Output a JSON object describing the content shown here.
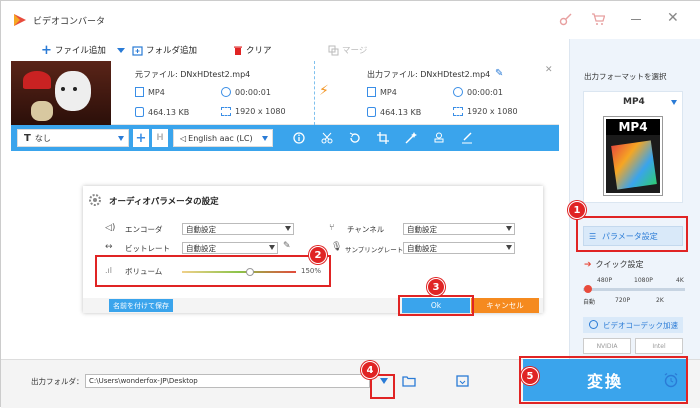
{
  "window": {
    "title": "ビデオコンバータ"
  },
  "toolbar": {
    "add_file": "ファイル追加",
    "add_folder": "フォルダ追加",
    "clear": "クリア",
    "merge": "マージ"
  },
  "file": {
    "source_name": "元ファイル: DNxHDtest2.mp4",
    "output_name": "出力ファイル: DNxHDtest2.mp4",
    "src_format": "MP4",
    "src_duration": "00:00:01",
    "src_size": "464.13 KB",
    "src_resolution": "1920 x 1080",
    "out_format": "MP4",
    "out_duration": "00:00:01",
    "out_size": "464.13 KB",
    "out_resolution": "1920 x 1080",
    "subtitle": "なし",
    "audio_track": "English aac (LC)"
  },
  "right_panel": {
    "choose_format": "出力フォーマットを選択",
    "format": "MP4",
    "format_icon_label": "MP4",
    "param_settings": "パラメータ設定",
    "quick_settings": "クイック設定",
    "quality_top": [
      "480P",
      "1080P",
      "4K"
    ],
    "quality_bottom": [
      "自動",
      "720P",
      "2K"
    ],
    "gpu_accel": "ビデオコーデック加速",
    "nvidia": "NVIDIA",
    "intel": "Intel"
  },
  "dialog": {
    "title": "オーディオパラメータの設定",
    "encoder_label": "エンコーダ",
    "encoder_value": "自動設定",
    "bitrate_label": "ビットレート",
    "bitrate_value": "自動設定",
    "volume_label": "ボリューム",
    "volume_value": "150%",
    "volume_level": 0.6,
    "channel_label": "チャンネル",
    "channel_value": "自動設定",
    "samplerate_label": "サンプリングレート",
    "samplerate_value": "自動設定",
    "save_as": "名前を付けて保存",
    "ok": "Ok",
    "cancel": "キャンセル"
  },
  "bottom": {
    "output_folder_label": "出力フォルダ：",
    "output_path": "C:\\Users\\wonderfox-JP\\Desktop",
    "convert": "変換"
  },
  "badges": [
    "1",
    "2",
    "3",
    "4",
    "5"
  ],
  "colors": {
    "accent": "#3aa4ec",
    "highlight": "#e02424",
    "cancel": "#f58a1f"
  }
}
